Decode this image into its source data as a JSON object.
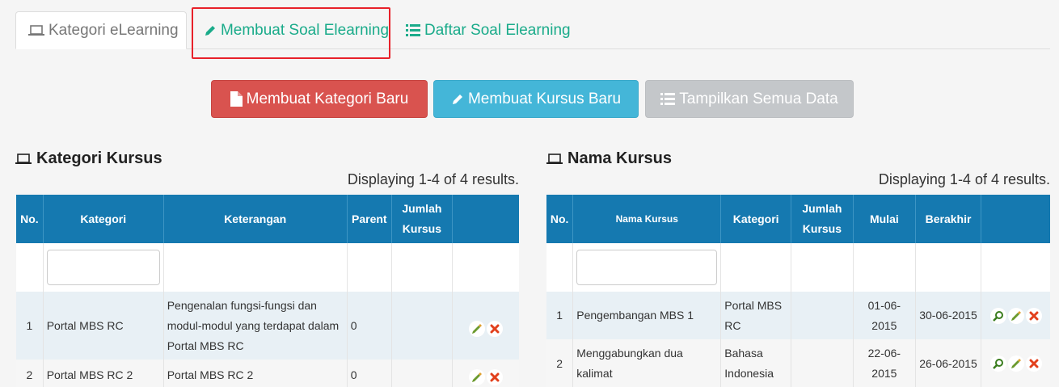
{
  "tabs": {
    "kategori": "Kategori eLearning",
    "membuat_soal": "Membuat Soal Elearning",
    "daftar_soal": "Daftar Soal Elearning"
  },
  "buttons": {
    "kategori_baru": "Membuat Kategori Baru",
    "kursus_baru": "Membuat Kursus Baru",
    "tampilkan": "Tampilkan Semua Data"
  },
  "kategori_section": {
    "title": "Kategori Kursus",
    "summary": "Displaying 1-4 of 4 results.",
    "headers": [
      "No.",
      "Kategori",
      "Keterangan",
      "Parent",
      "Jumlah Kursus",
      ""
    ],
    "rows": [
      {
        "no": "1",
        "kategori": "Portal MBS RC",
        "keterangan": "Pengenalan fungsi-fungsi dan modul-modul yang  terdapat dalam Portal MBS RC",
        "parent": "0",
        "jumlah": ""
      },
      {
        "no": "2",
        "kategori": "Portal MBS RC 2",
        "keterangan": "Portal MBS RC 2",
        "parent": "0",
        "jumlah": ""
      }
    ]
  },
  "kursus_section": {
    "title": "Nama Kursus",
    "summary": "Displaying 1-4 of 4 results.",
    "headers": [
      "No.",
      "Nama Kursus",
      "Kategori",
      "Jumlah Kursus",
      "Mulai",
      "Berakhir",
      ""
    ],
    "rows": [
      {
        "no": "1",
        "nama": "Pengembangan MBS 1",
        "kategori": "Portal MBS RC",
        "jumlah": "",
        "mulai": "01-06-2015",
        "berakhir": "30-06-2015"
      },
      {
        "no": "2",
        "nama": "Menggabungkan dua kalimat",
        "kategori": "Bahasa Indonesia",
        "jumlah": "",
        "mulai": "22-06-2015",
        "berakhir": "26-06-2015"
      }
    ]
  },
  "icons": [
    "laptop-icon",
    "pencil-icon",
    "list-icon",
    "file-icon",
    "search-icon",
    "edit-icon",
    "delete-icon"
  ],
  "colors": {
    "accent": "#1aab8a",
    "header": "#1579b0",
    "danger": "#d9534f",
    "info": "#44b6d8",
    "muted": "#c4c7ca",
    "highlight": "#e8212a"
  }
}
